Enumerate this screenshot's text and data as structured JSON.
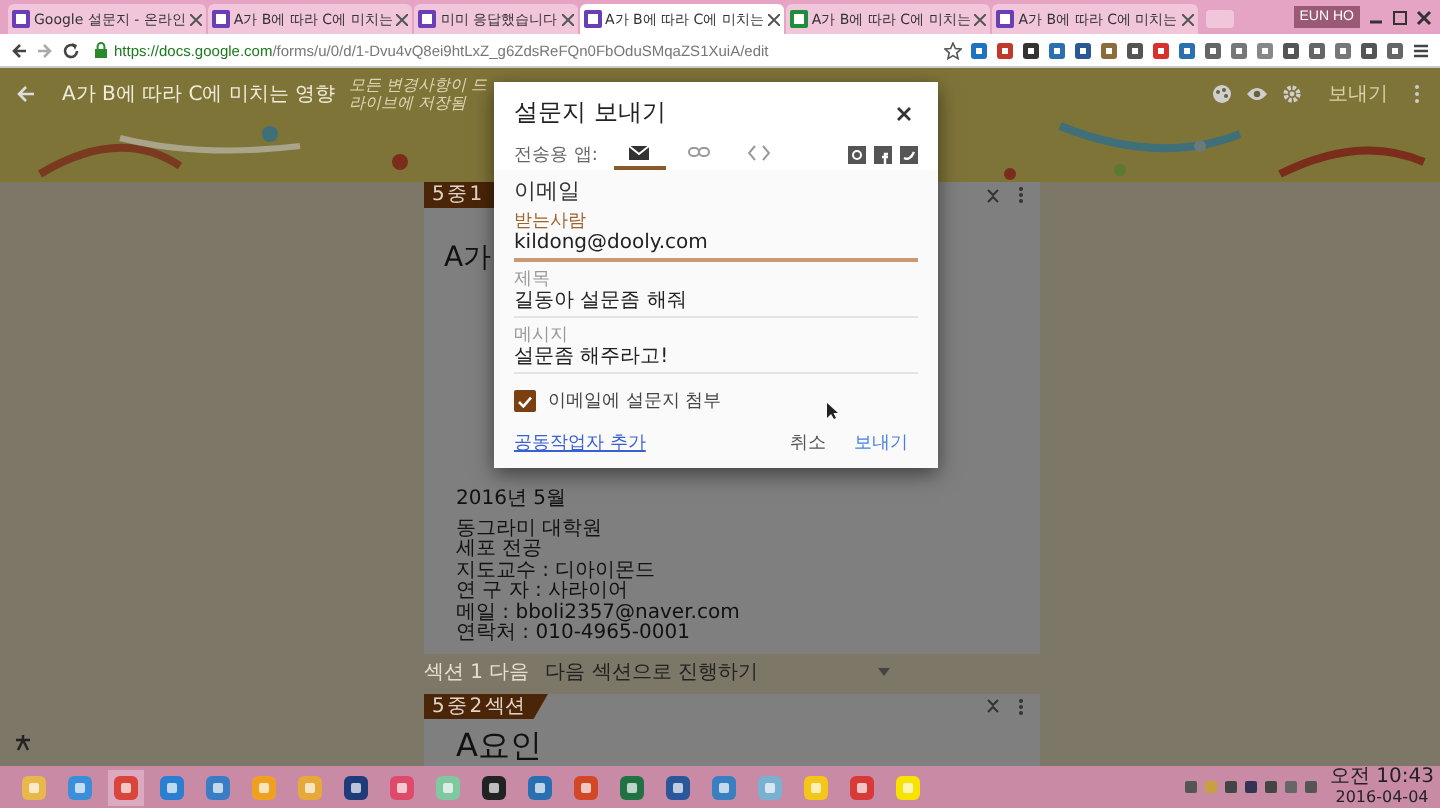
{
  "browser": {
    "tabs": [
      {
        "title": "Google 설문지 - 온라인",
        "kind": "forms",
        "selected": false
      },
      {
        "title": "A가 B에 따라 C에 미치는",
        "kind": "forms",
        "selected": false
      },
      {
        "title": "미미 응답했습니다",
        "kind": "forms",
        "selected": false
      },
      {
        "title": "A가 B에 따라 C에 미치는",
        "kind": "forms",
        "selected": true
      },
      {
        "title": "A가 B에 따라 C에 미치는",
        "kind": "sheets",
        "selected": false
      },
      {
        "title": "A가 B에 따라 C에 미치는",
        "kind": "forms",
        "selected": false
      }
    ],
    "user": "EUN HO",
    "url": {
      "host": "https://docs.google.com",
      "path": "/forms/u/0/d/1-Dvu4vQ8ei9htLxZ_g6ZdsReFQn0FbOduSMqaZS1XuiA/edit"
    }
  },
  "form_header": {
    "title": "A가 B에 따라 C에 미치는 영향",
    "status": "모든 변경사항이 드라이브에 저장됨",
    "send_button": "보내기"
  },
  "sections": [
    {
      "badge": "5 중 1",
      "title": "A가",
      "lines": [
        "2016년 5월",
        "동그라미 대학원",
        "세포 전공",
        "지도교수 : 디아이몬드",
        "연 구 자 : 사라이어",
        "메일 : bboli2357@naver.com",
        "연락처 : 010-4965-0001"
      ],
      "after_label": "섹션 1 다음",
      "after_value": "다음 섹션으로 진행하기"
    },
    {
      "badge": "5 중 2 섹션",
      "title": "A요인"
    }
  ],
  "dialog": {
    "title": "설문지 보내기",
    "via_label": "전송용 앱:",
    "via_tabs": [
      {
        "kind": "email",
        "selected": true
      },
      {
        "kind": "link",
        "selected": false
      },
      {
        "kind": "embed",
        "selected": false
      }
    ],
    "section_title": "이메일",
    "to": {
      "label": "받는사람",
      "value": "kildong@dooly.com"
    },
    "subject": {
      "label": "제목",
      "value": "길동아 설문좀 해줘"
    },
    "message": {
      "label": "메시지",
      "value": "설문좀 해주라고!"
    },
    "include_form": {
      "label": "이메일에 설문지 첨부",
      "checked": true
    },
    "collaborator_link": "공동작업자 추가",
    "cancel": "취소",
    "send": "보내기"
  },
  "taskbar": {
    "time": "오전 10:43",
    "date": "2016-04-04"
  }
}
